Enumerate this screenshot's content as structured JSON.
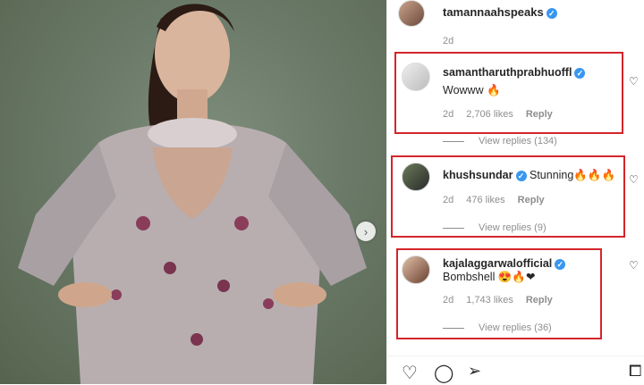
{
  "post": {
    "author": "tamannaahspeaks",
    "previous_time": "2d"
  },
  "comments": [
    {
      "username": "samantharuthprabhuoffl",
      "text": "Wowww 🔥",
      "time": "2d",
      "likes": "2,706 likes",
      "reply": "Reply",
      "view_replies": "View replies (134)"
    },
    {
      "username": "khushsundar",
      "text": "Stunning🔥🔥🔥",
      "time": "2d",
      "likes": "476 likes",
      "reply": "Reply",
      "view_replies": "View replies (9)"
    },
    {
      "username": "kajalaggarwalofficial",
      "text": "Bombshell 😍🔥❤",
      "time": "2d",
      "likes": "1,743 likes",
      "reply": "Reply",
      "view_replies": "View replies (36)"
    }
  ],
  "colors": {
    "highlight_box": "#d4252a",
    "verified": "#3897f0"
  },
  "icons": [
    "heart-icon",
    "comment-icon",
    "share-icon",
    "save-icon",
    "next-arrow-icon",
    "verified-icon"
  ]
}
